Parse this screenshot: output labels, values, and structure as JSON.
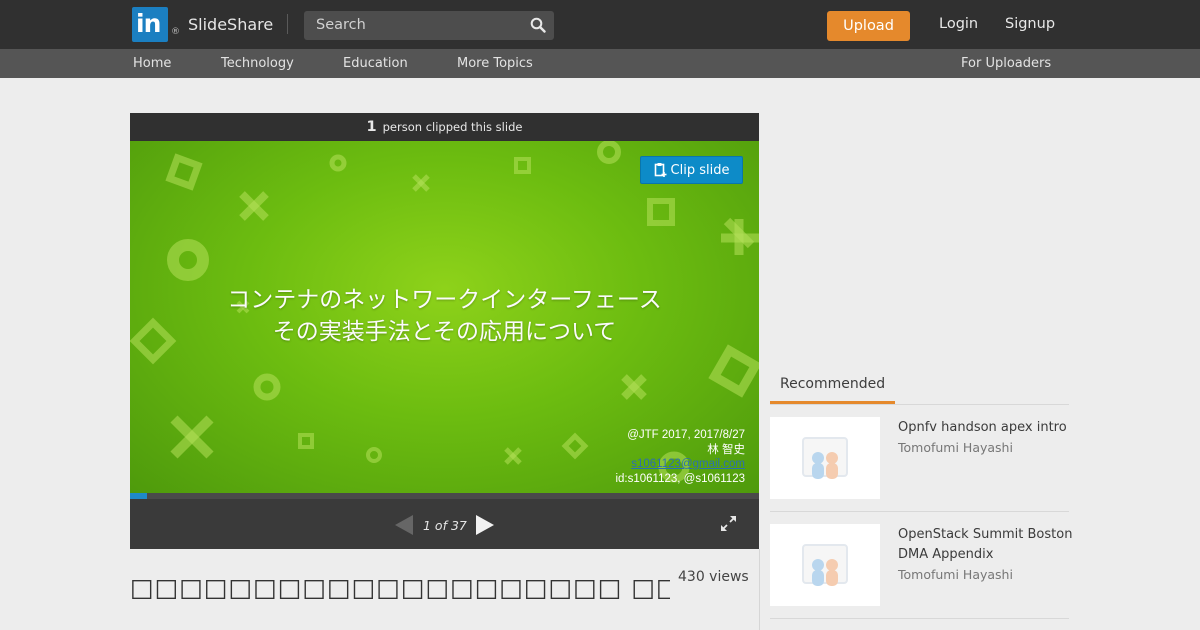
{
  "header": {
    "logo_text": "in",
    "logo_reg": "®",
    "brand": "SlideShare",
    "search_placeholder": "Search",
    "upload_label": "Upload",
    "login_label": "Login",
    "signup_label": "Signup",
    "accent_color": "#e5892c"
  },
  "nav": {
    "items": [
      "Home",
      "Technology",
      "Education",
      "More Topics"
    ],
    "for_uploaders": "For Uploaders"
  },
  "player": {
    "clip_count": "1",
    "clip_text": "person clipped this slide",
    "clip_button": "Clip slide",
    "slide_title_line1": "コンテナのネットワークインターフェース",
    "slide_title_line2": "その実装手法とその応用について",
    "slide_info": {
      "event": "@JTF 2017, 2017/8/27",
      "author": "林 智史",
      "email": "s1061123@gmail.com",
      "ids": "id:s1061123, @s1061123"
    },
    "page_indicator": "1 of 37",
    "current_page": 1,
    "total_pages": 37,
    "progress_color": "#1f89c8"
  },
  "document": {
    "title": "□□□□□□□□□□□□□□□□□□□□ □□□□□□□□□□□□□□□",
    "views": "430 views"
  },
  "sidebar": {
    "tab_label": "Recommended",
    "items": [
      {
        "title": "Opnfv handson apex intro",
        "author": "Tomofumi Hayashi"
      },
      {
        "title": "OpenStack Summit Boston DMA Appendix",
        "author": "Tomofumi Hayashi"
      }
    ]
  }
}
